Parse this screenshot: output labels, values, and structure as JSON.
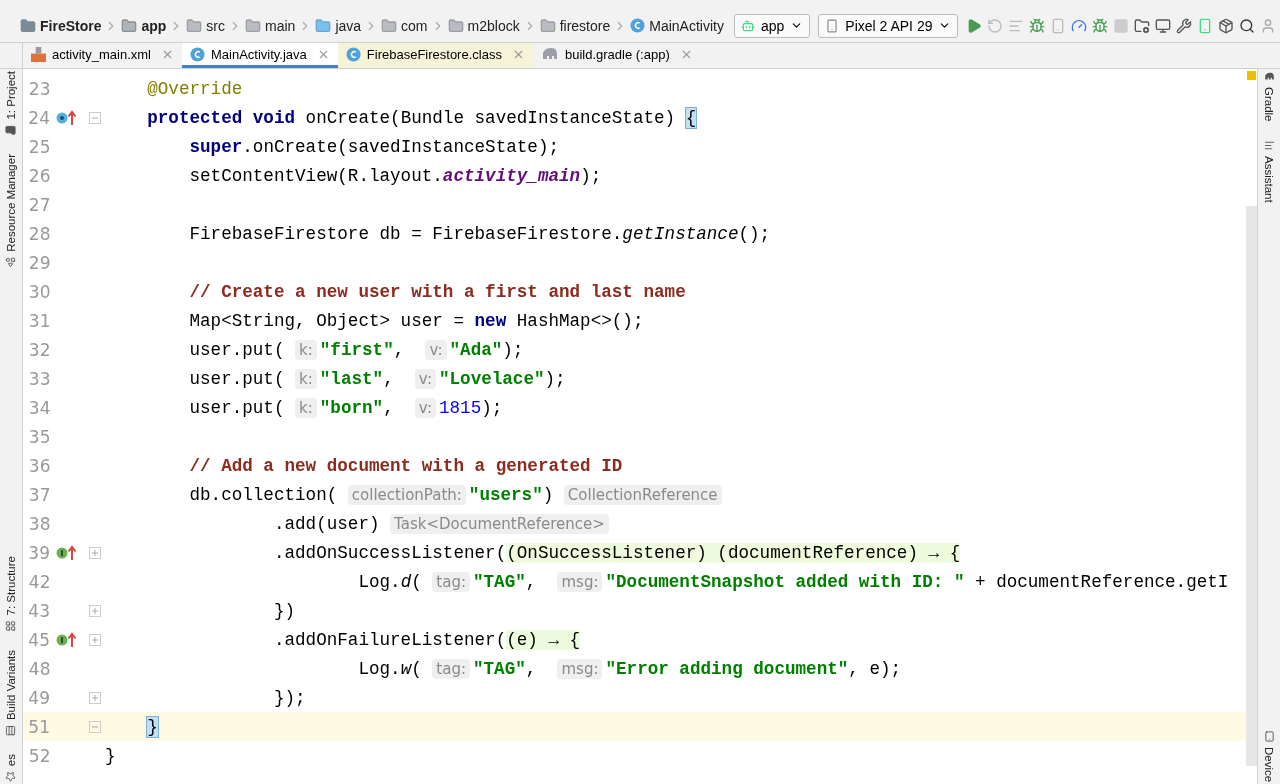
{
  "breadcrumbs": [
    {
      "label": "FireStore",
      "kind": "project"
    },
    {
      "label": "app",
      "kind": "module"
    },
    {
      "label": "src",
      "kind": "folder"
    },
    {
      "label": "main",
      "kind": "folder"
    },
    {
      "label": "java",
      "kind": "source"
    },
    {
      "label": "com",
      "kind": "package"
    },
    {
      "label": "m2block",
      "kind": "package"
    },
    {
      "label": "firestore",
      "kind": "package"
    },
    {
      "label": "MainActivity",
      "kind": "class"
    }
  ],
  "run_config": "app",
  "device": "Pixel 2 API 29",
  "tabs": [
    {
      "label": "activity_main.xml",
      "kind": "xml",
      "selected": false
    },
    {
      "label": "MainActivity.java",
      "kind": "java",
      "selected": true
    },
    {
      "label": "FirebaseFirestore.class",
      "kind": "class",
      "selected": false
    },
    {
      "label": "build.gradle (:app)",
      "kind": "gradle",
      "selected": false
    }
  ],
  "left_tools": [
    {
      "label": "1: Project",
      "kind": "project"
    },
    {
      "label": "Resource Manager",
      "kind": "resources"
    },
    {
      "label": "7: Structure",
      "kind": "structure"
    },
    {
      "label": "Build Variants",
      "kind": "variants"
    },
    {
      "label": "es",
      "kind": "favorites"
    }
  ],
  "right_tools": [
    {
      "label": "Gradle",
      "kind": "gradle"
    },
    {
      "label": "Assistant",
      "kind": "assistant"
    },
    {
      "label": "Device",
      "kind": "device"
    }
  ],
  "lines": [
    {
      "number": "23",
      "tokens": [
        {
          "kind": "annotation",
          "text": "    @Override"
        }
      ]
    },
    {
      "number": "24",
      "marker": {
        "kind": "override"
      },
      "fold": {
        "expanded": true
      },
      "tokens": [
        {
          "kind": "keyword",
          "text": "    protected "
        },
        {
          "kind": "keyword",
          "text": "void"
        },
        {
          "kind": "plain",
          "text": " onCreate(Bundle savedInstanceState) "
        },
        {
          "kind": "brace",
          "text": "{"
        }
      ]
    },
    {
      "number": "25",
      "tokens": [
        {
          "kind": "keyword",
          "text": "        super"
        },
        {
          "kind": "plain",
          "text": ".onCreate(savedInstanceState);"
        }
      ]
    },
    {
      "number": "26",
      "tokens": [
        {
          "kind": "plain",
          "text": "        setContentView(R.layout."
        },
        {
          "kind": "field",
          "text": "activity_main"
        },
        {
          "kind": "plain",
          "text": ");"
        }
      ]
    },
    {
      "number": "27"
    },
    {
      "number": "28",
      "tokens": [
        {
          "kind": "plain",
          "text": "        FirebaseFirestore db = FirebaseFirestore."
        },
        {
          "kind": "static",
          "text": "getInstance"
        },
        {
          "kind": "plain",
          "text": "();"
        }
      ]
    },
    {
      "number": "29"
    },
    {
      "number": "30",
      "tokens": [
        {
          "kind": "comment",
          "text": "        // Create a new user with a first and last name"
        }
      ]
    },
    {
      "number": "31",
      "tokens": [
        {
          "kind": "plain",
          "text": "        Map<String, Object> user = "
        },
        {
          "kind": "keyword",
          "text": "new"
        },
        {
          "kind": "plain",
          "text": " HashMap<>();"
        }
      ]
    },
    {
      "number": "32",
      "tokens": [
        {
          "kind": "plain",
          "text": "        user.put( "
        },
        {
          "kind": "hint",
          "text": "k:"
        },
        {
          "kind": "string",
          "text": "\"first\""
        },
        {
          "kind": "plain",
          "text": ",  "
        },
        {
          "kind": "hint",
          "text": "v:"
        },
        {
          "kind": "string",
          "text": "\"Ada\""
        },
        {
          "kind": "plain",
          "text": ");"
        }
      ]
    },
    {
      "number": "33",
      "tokens": [
        {
          "kind": "plain",
          "text": "        user.put( "
        },
        {
          "kind": "hint",
          "text": "k:"
        },
        {
          "kind": "string",
          "text": "\"last\""
        },
        {
          "kind": "plain",
          "text": ",  "
        },
        {
          "kind": "hint",
          "text": "v:"
        },
        {
          "kind": "string",
          "text": "\"Lovelace\""
        },
        {
          "kind": "plain",
          "text": ");"
        }
      ]
    },
    {
      "number": "34",
      "tokens": [
        {
          "kind": "plain",
          "text": "        user.put( "
        },
        {
          "kind": "hint",
          "text": "k:"
        },
        {
          "kind": "string",
          "text": "\"born\""
        },
        {
          "kind": "plain",
          "text": ",  "
        },
        {
          "kind": "hint",
          "text": "v:"
        },
        {
          "kind": "number",
          "text": "1815"
        },
        {
          "kind": "plain",
          "text": ");"
        }
      ]
    },
    {
      "number": "35"
    },
    {
      "number": "36",
      "tokens": [
        {
          "kind": "comment",
          "text": "        // Add a new document with a generated ID"
        }
      ]
    },
    {
      "number": "37",
      "tokens": [
        {
          "kind": "plain",
          "text": "        db.collection( "
        },
        {
          "kind": "hint",
          "text": "collectionPath:"
        },
        {
          "kind": "string",
          "text": "\"users\""
        },
        {
          "kind": "plain",
          "text": ") "
        },
        {
          "kind": "typehint",
          "text": "CollectionReference"
        }
      ]
    },
    {
      "number": "38",
      "tokens": [
        {
          "kind": "plain",
          "text": "                .add(user) "
        },
        {
          "kind": "typehint",
          "text": "Task<DocumentReference>"
        }
      ]
    },
    {
      "number": "39",
      "marker": {
        "kind": "implements"
      },
      "fold": {
        "expanded": false
      },
      "tokens": [
        {
          "kind": "plain",
          "text": "                .addOnSuccessListener("
        },
        {
          "kind": "lambda",
          "text": "(OnSuccessListener) (documentReference) → {"
        }
      ]
    },
    {
      "number": "42",
      "tokens": [
        {
          "kind": "plain",
          "text": "                        Log."
        },
        {
          "kind": "static",
          "text": "d"
        },
        {
          "kind": "plain",
          "text": "( "
        },
        {
          "kind": "hint",
          "text": "tag:"
        },
        {
          "kind": "string",
          "text": "\"TAG\""
        },
        {
          "kind": "plain",
          "text": ",  "
        },
        {
          "kind": "hint",
          "text": "msg:"
        },
        {
          "kind": "string",
          "text": "\"DocumentSnapshot added with ID: \""
        },
        {
          "kind": "plain",
          "text": " + documentReference.getI"
        }
      ]
    },
    {
      "number": "43",
      "fold": {
        "expanded": false
      },
      "tokens": [
        {
          "kind": "plain",
          "text": "                })"
        }
      ]
    },
    {
      "number": "45",
      "marker": {
        "kind": "implements"
      },
      "fold": {
        "expanded": false
      },
      "tokens": [
        {
          "kind": "plain",
          "text": "                .addOnFailureListener("
        },
        {
          "kind": "lambda",
          "text": "(e) → {"
        }
      ]
    },
    {
      "number": "48",
      "tokens": [
        {
          "kind": "plain",
          "text": "                        Log."
        },
        {
          "kind": "static",
          "text": "w"
        },
        {
          "kind": "plain",
          "text": "( "
        },
        {
          "kind": "hint",
          "text": "tag:"
        },
        {
          "kind": "string",
          "text": "\"TAG\""
        },
        {
          "kind": "plain",
          "text": ",  "
        },
        {
          "kind": "hint",
          "text": "msg:"
        },
        {
          "kind": "string",
          "text": "\"Error adding document\""
        },
        {
          "kind": "plain",
          "text": ", e);"
        }
      ]
    },
    {
      "number": "49",
      "fold": {
        "expanded": false
      },
      "tokens": [
        {
          "kind": "plain",
          "text": "                });"
        }
      ]
    },
    {
      "number": "51",
      "fold": {
        "expanded": true
      },
      "current": true,
      "tokens": [
        {
          "kind": "brace",
          "text": "    }"
        }
      ]
    },
    {
      "number": "52",
      "tokens": [
        {
          "kind": "plain",
          "text": "}"
        }
      ]
    }
  ]
}
